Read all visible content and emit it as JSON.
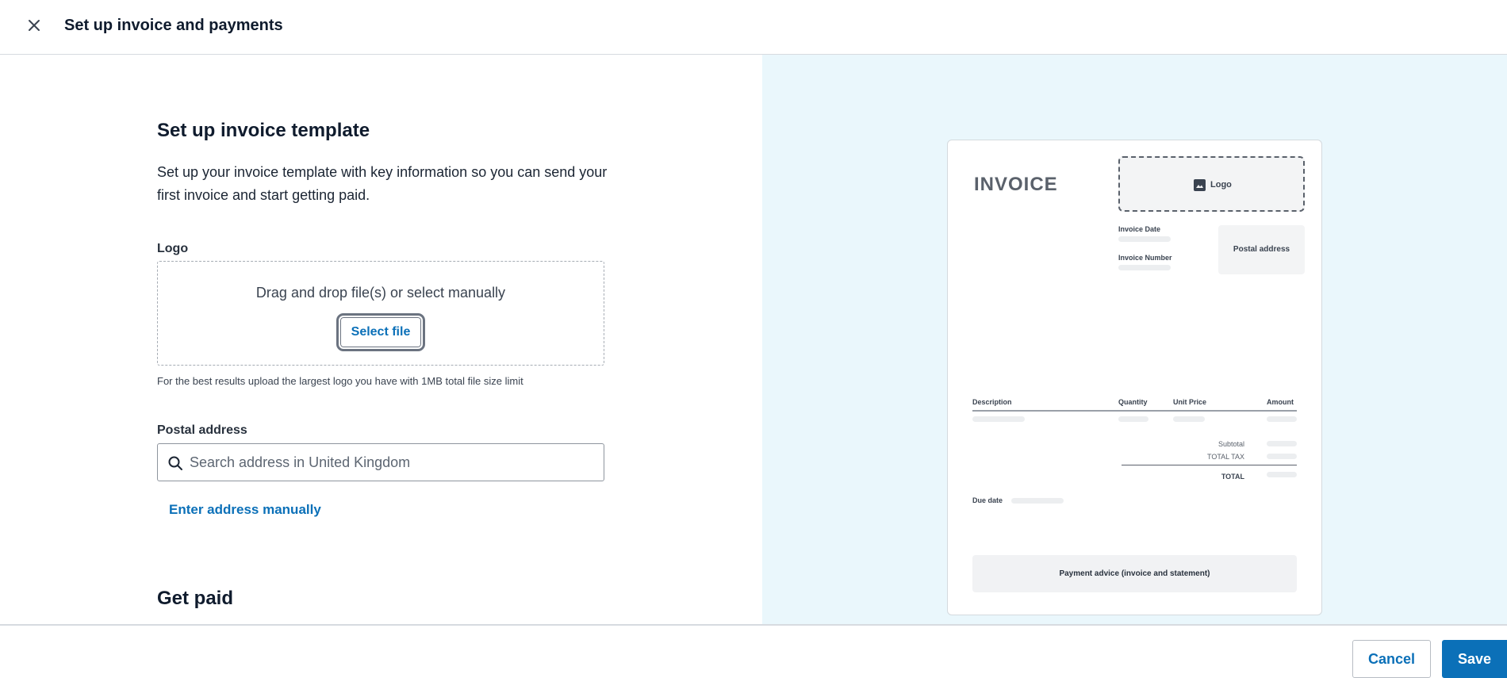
{
  "header": {
    "title": "Set up invoice and payments",
    "close_icon": "close-icon"
  },
  "form": {
    "section_title": "Set up invoice template",
    "intro": "Set up your invoice template with key information so you can send your first invoice and start getting paid.",
    "logo": {
      "label": "Logo",
      "drop_text": "Drag and drop file(s) or select manually",
      "select_button": "Select file",
      "hint": "For the best results upload the largest logo you have with 1MB total file size limit"
    },
    "postal": {
      "label": "Postal address",
      "placeholder": "Search address in United Kingdom",
      "value": "",
      "manual_link": "Enter address manually"
    },
    "next_section_title": "Get paid"
  },
  "preview": {
    "title": "INVOICE",
    "logo_label": "Logo",
    "invoice_date_label": "Invoice Date",
    "invoice_number_label": "Invoice Number",
    "postal_address": "Postal address",
    "columns": [
      "Description",
      "Quantity",
      "Unit Price",
      "Amount"
    ],
    "subtotal": "Subtotal",
    "total_tax": "TOTAL TAX",
    "total": "TOTAL",
    "due_date": "Due date",
    "payment_advice": "Payment advice (invoice and statement)"
  },
  "footer": {
    "cancel": "Cancel",
    "save": "Save"
  },
  "colors": {
    "accent": "#0b70b8",
    "preview_bg": "#eaf7fc"
  }
}
